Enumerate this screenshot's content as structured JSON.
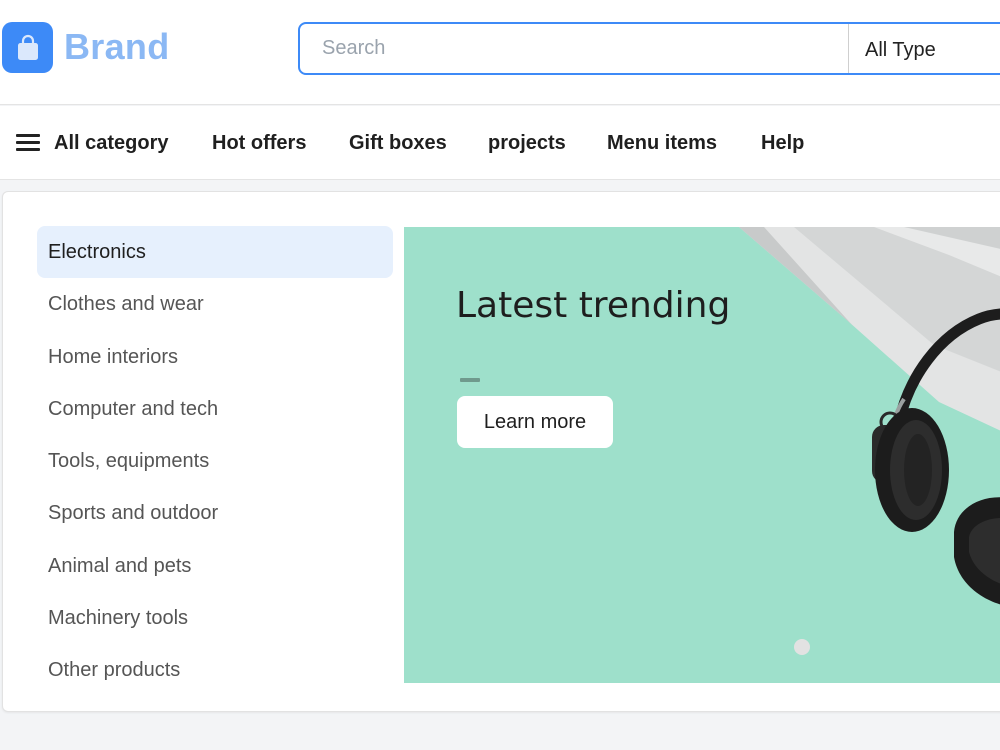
{
  "header": {
    "brand": "Brand",
    "logo_icon": "shopping-bag-icon",
    "search": {
      "placeholder": "Search",
      "value": ""
    },
    "type_select": "All Type"
  },
  "nav": {
    "menu_icon": "hamburger-icon",
    "items": [
      "All category",
      "Hot offers",
      "Gift boxes",
      "projects",
      "Menu items",
      "Help"
    ]
  },
  "categories": {
    "active_index": 0,
    "items": [
      "Electronics",
      "Clothes and wear",
      "Home interiors",
      "Computer and tech",
      "Tools, equipments",
      "Sports and outdoor",
      "Animal and pets",
      "Machinery tools",
      "Other products"
    ]
  },
  "banner": {
    "title": "Latest trending",
    "button": "Learn more",
    "background": "#9ee0cb",
    "image": "headphones-laptop-photo"
  },
  "colors": {
    "accent": "#3d8af7",
    "active_bg": "#e6f0fd"
  }
}
